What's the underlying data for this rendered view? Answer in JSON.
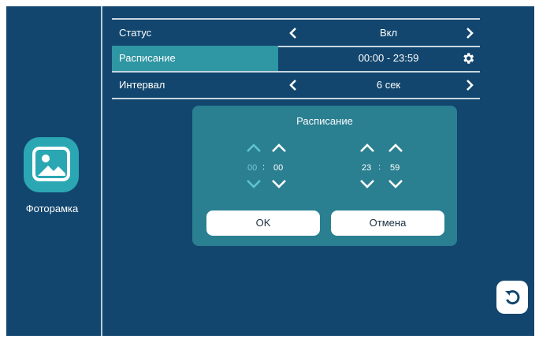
{
  "app": {
    "label": "Фоторамка",
    "icon": "image-icon"
  },
  "settings": {
    "rows": [
      {
        "label": "Статус",
        "value": "Вкл"
      },
      {
        "label": "Расписание",
        "value": "00:00 - 23:59"
      },
      {
        "label": "Интервал",
        "value": "6 сек"
      }
    ]
  },
  "dialog": {
    "title": "Расписание",
    "start": {
      "hours": "00",
      "minutes": "00",
      "separator": ":"
    },
    "end": {
      "hours": "23",
      "minutes": "59",
      "separator": ":"
    },
    "ok_label": "OK",
    "cancel_label": "Отмена"
  },
  "colors": {
    "background": "#12466e",
    "accent": "#2aa7b3",
    "selected_row": "#2f96a3",
    "dialog": "#2a7f91",
    "dim_text": "#7cc9d3"
  },
  "icons": {
    "back": "back-arrow-icon",
    "gear": "gear-icon",
    "chevrons": [
      "chevron-left-icon",
      "chevron-right-icon",
      "chevron-up-icon",
      "chevron-down-icon"
    ]
  }
}
